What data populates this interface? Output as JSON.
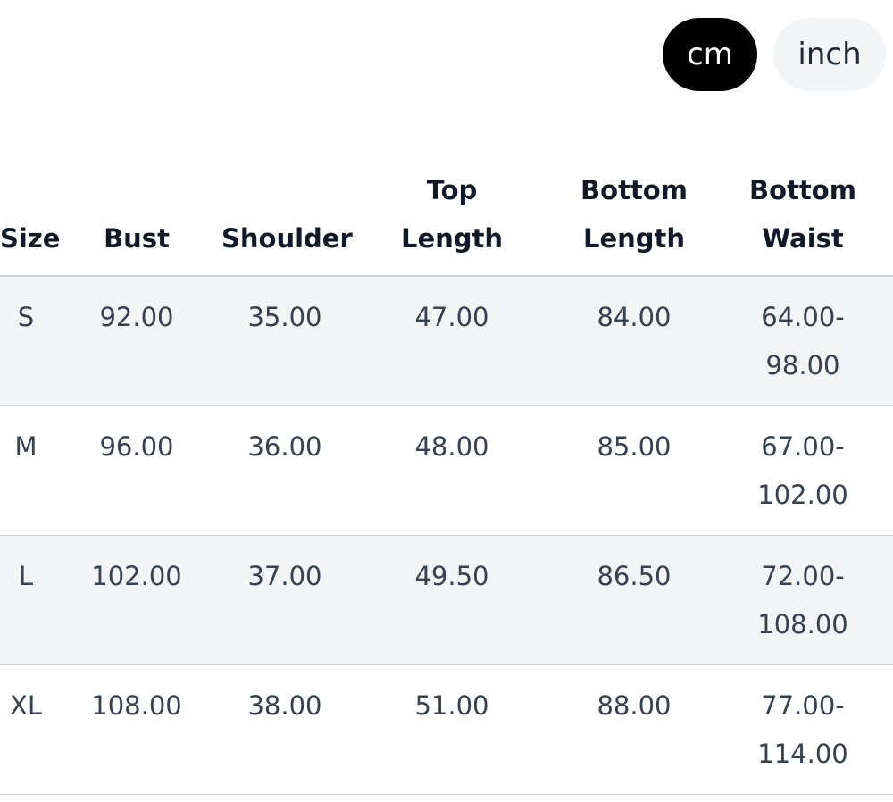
{
  "unit_toggle": {
    "options": [
      {
        "label": "cm",
        "active": true
      },
      {
        "label": "inch",
        "active": false
      }
    ],
    "active_color": "#000000",
    "inactive_color": "#f3f4f6"
  },
  "table": {
    "headers": [
      {
        "lines": [
          "Size"
        ]
      },
      {
        "lines": [
          "Bust"
        ]
      },
      {
        "lines": [
          "Shoulder"
        ]
      },
      {
        "lines": [
          "Top",
          "Length"
        ]
      },
      {
        "lines": [
          "Bottom",
          "Length"
        ]
      },
      {
        "lines": [
          "Bottom",
          "Waist"
        ]
      }
    ],
    "rows": [
      {
        "size": "S",
        "bust": "92.00",
        "shoulder": "35.00",
        "top_length": "47.00",
        "bottom_length": "84.00",
        "bottom_waist": [
          "64.00-",
          "98.00"
        ]
      },
      {
        "size": "M",
        "bust": "96.00",
        "shoulder": "36.00",
        "top_length": "48.00",
        "bottom_length": "85.00",
        "bottom_waist": [
          "67.00-",
          "102.00"
        ]
      },
      {
        "size": "L",
        "bust": "102.00",
        "shoulder": "37.00",
        "top_length": "49.50",
        "bottom_length": "86.50",
        "bottom_waist": [
          "72.00-",
          "108.00"
        ]
      },
      {
        "size": "XL",
        "bust": "108.00",
        "shoulder": "38.00",
        "top_length": "51.00",
        "bottom_length": "88.00",
        "bottom_waist": [
          "77.00-",
          "114.00"
        ]
      }
    ]
  }
}
